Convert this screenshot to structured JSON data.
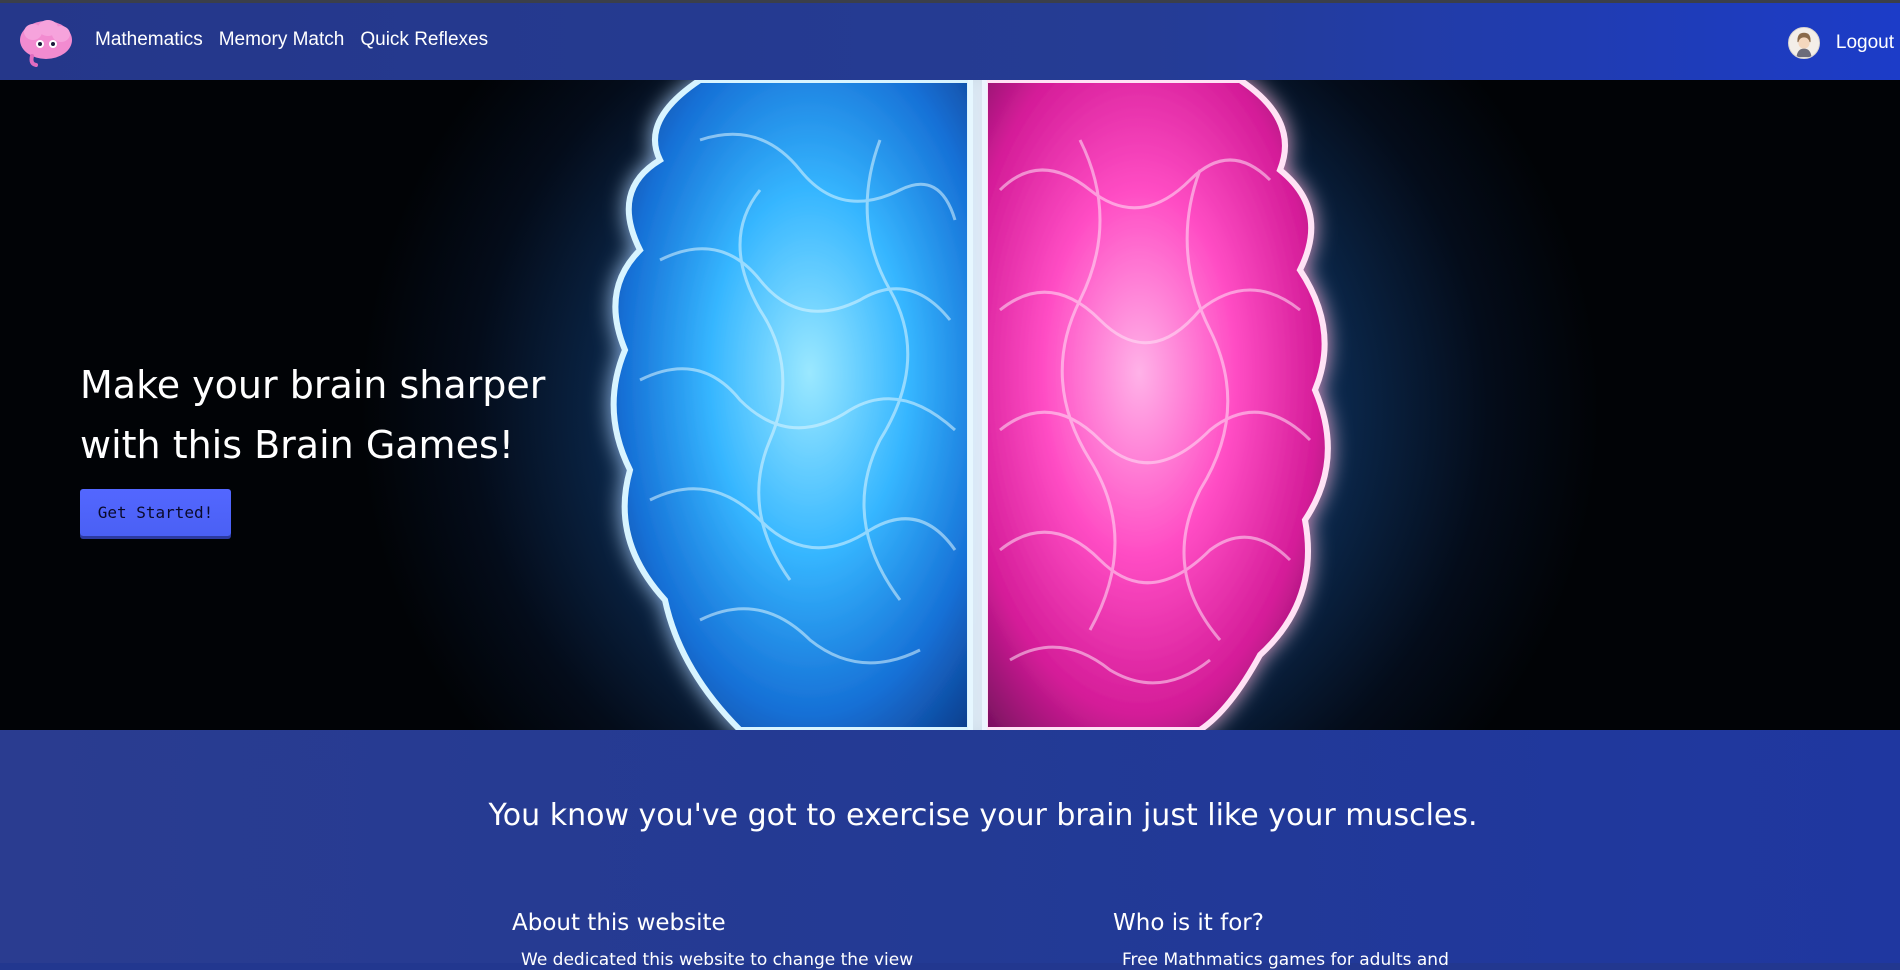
{
  "nav": {
    "links": [
      "Mathematics",
      "Memory Match",
      "Quick Reflexes"
    ],
    "logout_label": "Logout"
  },
  "hero": {
    "title": "Make your brain sharper with this Brain Games!",
    "cta_label": "Get Started!"
  },
  "info": {
    "tagline": "You know you've got to exercise your brain just like your muscles.",
    "columns": [
      {
        "heading": "About this website",
        "text": "We dedicated this website to change the view"
      },
      {
        "heading": "Who is it for?",
        "text": "Free Mathmatics games for adults and"
      }
    ]
  },
  "icons": {
    "logo": "brain-logo-icon",
    "avatar": "user-avatar-icon"
  },
  "colors": {
    "nav_bg": "#25378a",
    "cta_bg": "#4a60f4",
    "brain_left": "#33b8ff",
    "brain_right": "#ff2fb3",
    "section_bg": "#233a94"
  }
}
